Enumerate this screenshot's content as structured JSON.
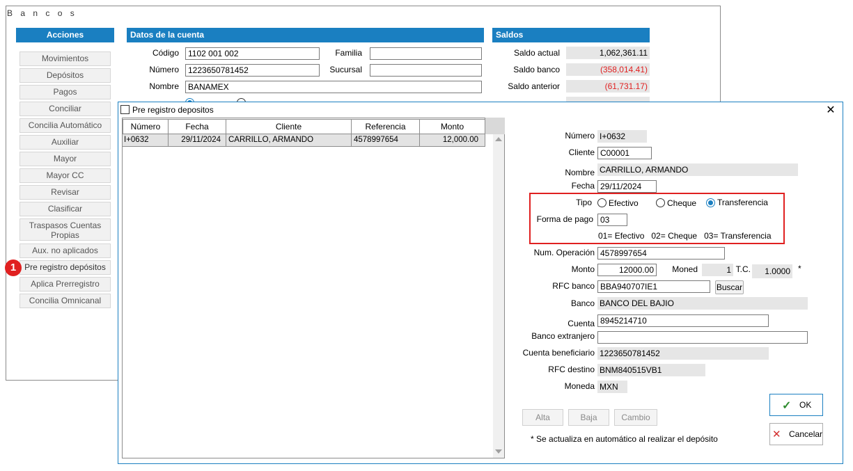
{
  "window": {
    "title": "B a n c o s"
  },
  "acciones": {
    "header": "Acciones",
    "items": [
      "Movimientos",
      "Depósitos",
      "Pagos",
      "Conciliar",
      "Concilia Automático",
      "Auxiliar",
      "Mayor",
      "Mayor CC",
      "Revisar",
      "Clasificar",
      "Traspasos  Cuentas Propias",
      "Aux. no aplicados",
      "Pre registro depósitos",
      "Aplica Prerregistro",
      "Concilia Omnicanal"
    ],
    "badge": "1"
  },
  "cuenta": {
    "header": "Datos de la cuenta",
    "codigo_label": "Código",
    "codigo": "1102 001 002",
    "familia_label": "Familia",
    "familia": "",
    "numero_label": "Número",
    "numero": "1223650781452",
    "sucursal_label": "Sucursal",
    "sucursal": "",
    "nombre_label": "Nombre",
    "nombre": "BANAMEX"
  },
  "saldos": {
    "header": "Saldos",
    "actual_label": "Saldo actual",
    "actual": "1,062,361.11",
    "banco_label": "Saldo banco",
    "banco": "(358,014.41)",
    "anterior_label": "Saldo anterior",
    "anterior": "(61,731.17)",
    "negative_color": "#e02020"
  },
  "dialog": {
    "title": "Pre registro depositos",
    "close": "✕",
    "grid": {
      "columns": [
        "Número",
        "Fecha",
        "Cliente",
        "Referencia",
        "Monto"
      ],
      "rows": [
        {
          "numero": "I+0632",
          "fecha": "29/11/2024",
          "cliente": "CARRILLO, ARMANDO",
          "referencia": "4578997654",
          "monto": "12,000.00"
        }
      ]
    },
    "form": {
      "numero_label": "Número",
      "numero": "I+0632",
      "cliente_label": "Cliente",
      "cliente": "C00001",
      "nombre_label": "Nombre",
      "nombre": "CARRILLO, ARMANDO",
      "fecha_label": "Fecha",
      "fecha": "29/11/2024",
      "tipo_label": "Tipo",
      "tipo_options": [
        "Efectivo",
        "Cheque",
        "Transferencia"
      ],
      "tipo_selected": "Transferencia",
      "forma_pago_label": "Forma de pago",
      "forma_pago": "03",
      "forma_pago_hint": "01= Efectivo   02= Cheque   03= Transferencia",
      "num_operacion_label": "Num. Operación",
      "num_operacion": "4578997654",
      "monto_label": "Monto",
      "monto": "12000.00",
      "moned_label": "Moned",
      "moned": "1",
      "tc_label": "T.C.",
      "tc": "1.0000",
      "tc_mark": "*",
      "rfc_banco_label": "RFC banco",
      "rfc_banco": "BBA940707IE1",
      "buscar": "Buscar",
      "banco_label": "Banco",
      "banco": "BANCO DEL BAJIO",
      "cuenta_label": "Cuenta",
      "cuenta": "8945214710",
      "banco_extranjero_label": "Banco extranjero",
      "banco_extranjero": "",
      "cuenta_beneficiario_label": "Cuenta beneficiario",
      "cuenta_beneficiario": "1223650781452",
      "rfc_destino_label": "RFC destino",
      "rfc_destino": "BNM840515VB1",
      "moneda_label": "Moneda",
      "moneda": "MXN"
    },
    "buttons": {
      "alta": "Alta",
      "baja": "Baja",
      "cambio": "Cambio",
      "ok": "OK",
      "cancelar": "Cancelar"
    },
    "note": "* Se actualiza en automático al realizar el depósito",
    "colors": {
      "accent": "#1a7fc1",
      "highlight_box": "#e02020",
      "ok_check": "#2e8b2e",
      "cancel_x": "#d32f2f"
    }
  }
}
